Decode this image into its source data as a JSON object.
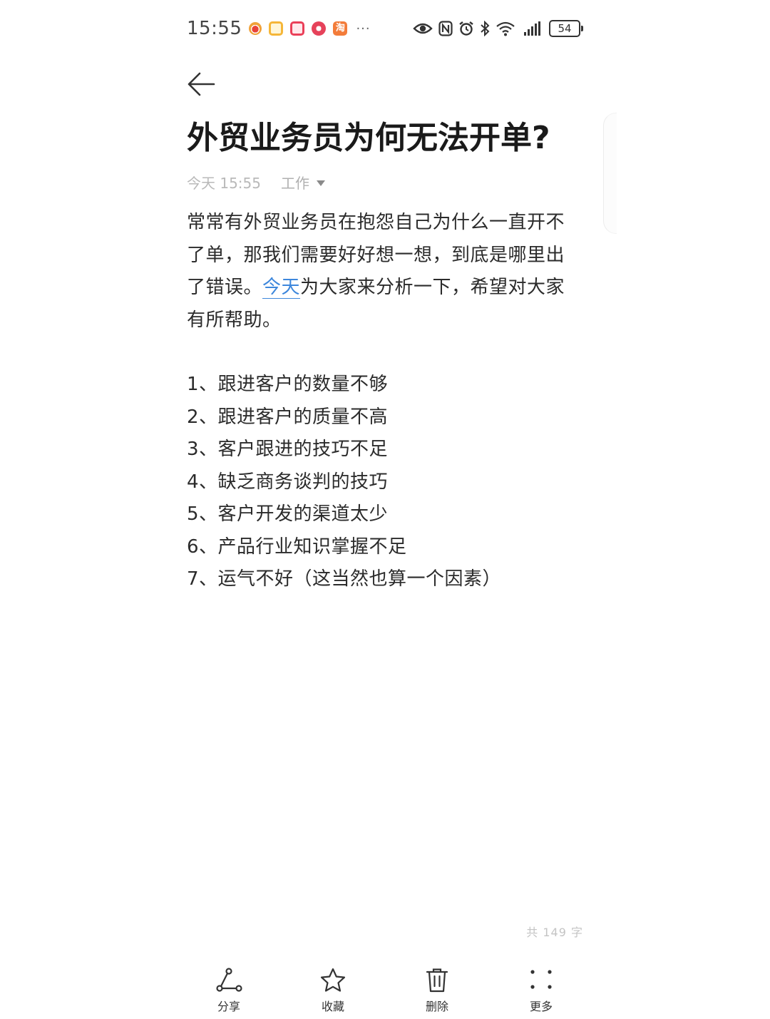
{
  "status_bar": {
    "time": "15:55",
    "notification_icons": [
      "weibo-icon",
      "message-icon",
      "red-app-icon",
      "flower-app-icon",
      "taobao-icon"
    ],
    "taobao_glyph": "淘",
    "more_dots": "···",
    "battery": "54"
  },
  "note": {
    "title": "外贸业务员为何无法开单?",
    "date": "今天 15:55",
    "folder": "工作",
    "intro_before_link": "常常有外贸业务员在抱怨自己为什么一直开不了单，那我们需要好好想一想，到底是哪里出了错误。",
    "intro_link": "今天",
    "intro_after_link": "为大家来分析一下，希望对大家有所帮助。",
    "items": [
      "1、跟进客户的数量不够",
      "2、跟进客户的质量不高",
      "3、客户跟进的技巧不足",
      "4、缺乏商务谈判的技巧",
      "5、客户开发的渠道太少",
      "6、产品行业知识掌握不足",
      "7、运气不好（这当然也算一个因素）"
    ],
    "word_count": "共 149 字"
  },
  "toolbar": {
    "share": "分享",
    "favorite": "收藏",
    "delete": "删除",
    "more": "更多"
  },
  "colors": {
    "link": "#3d87dc",
    "text": "#2b2b2b",
    "muted": "#b9b9b9"
  }
}
